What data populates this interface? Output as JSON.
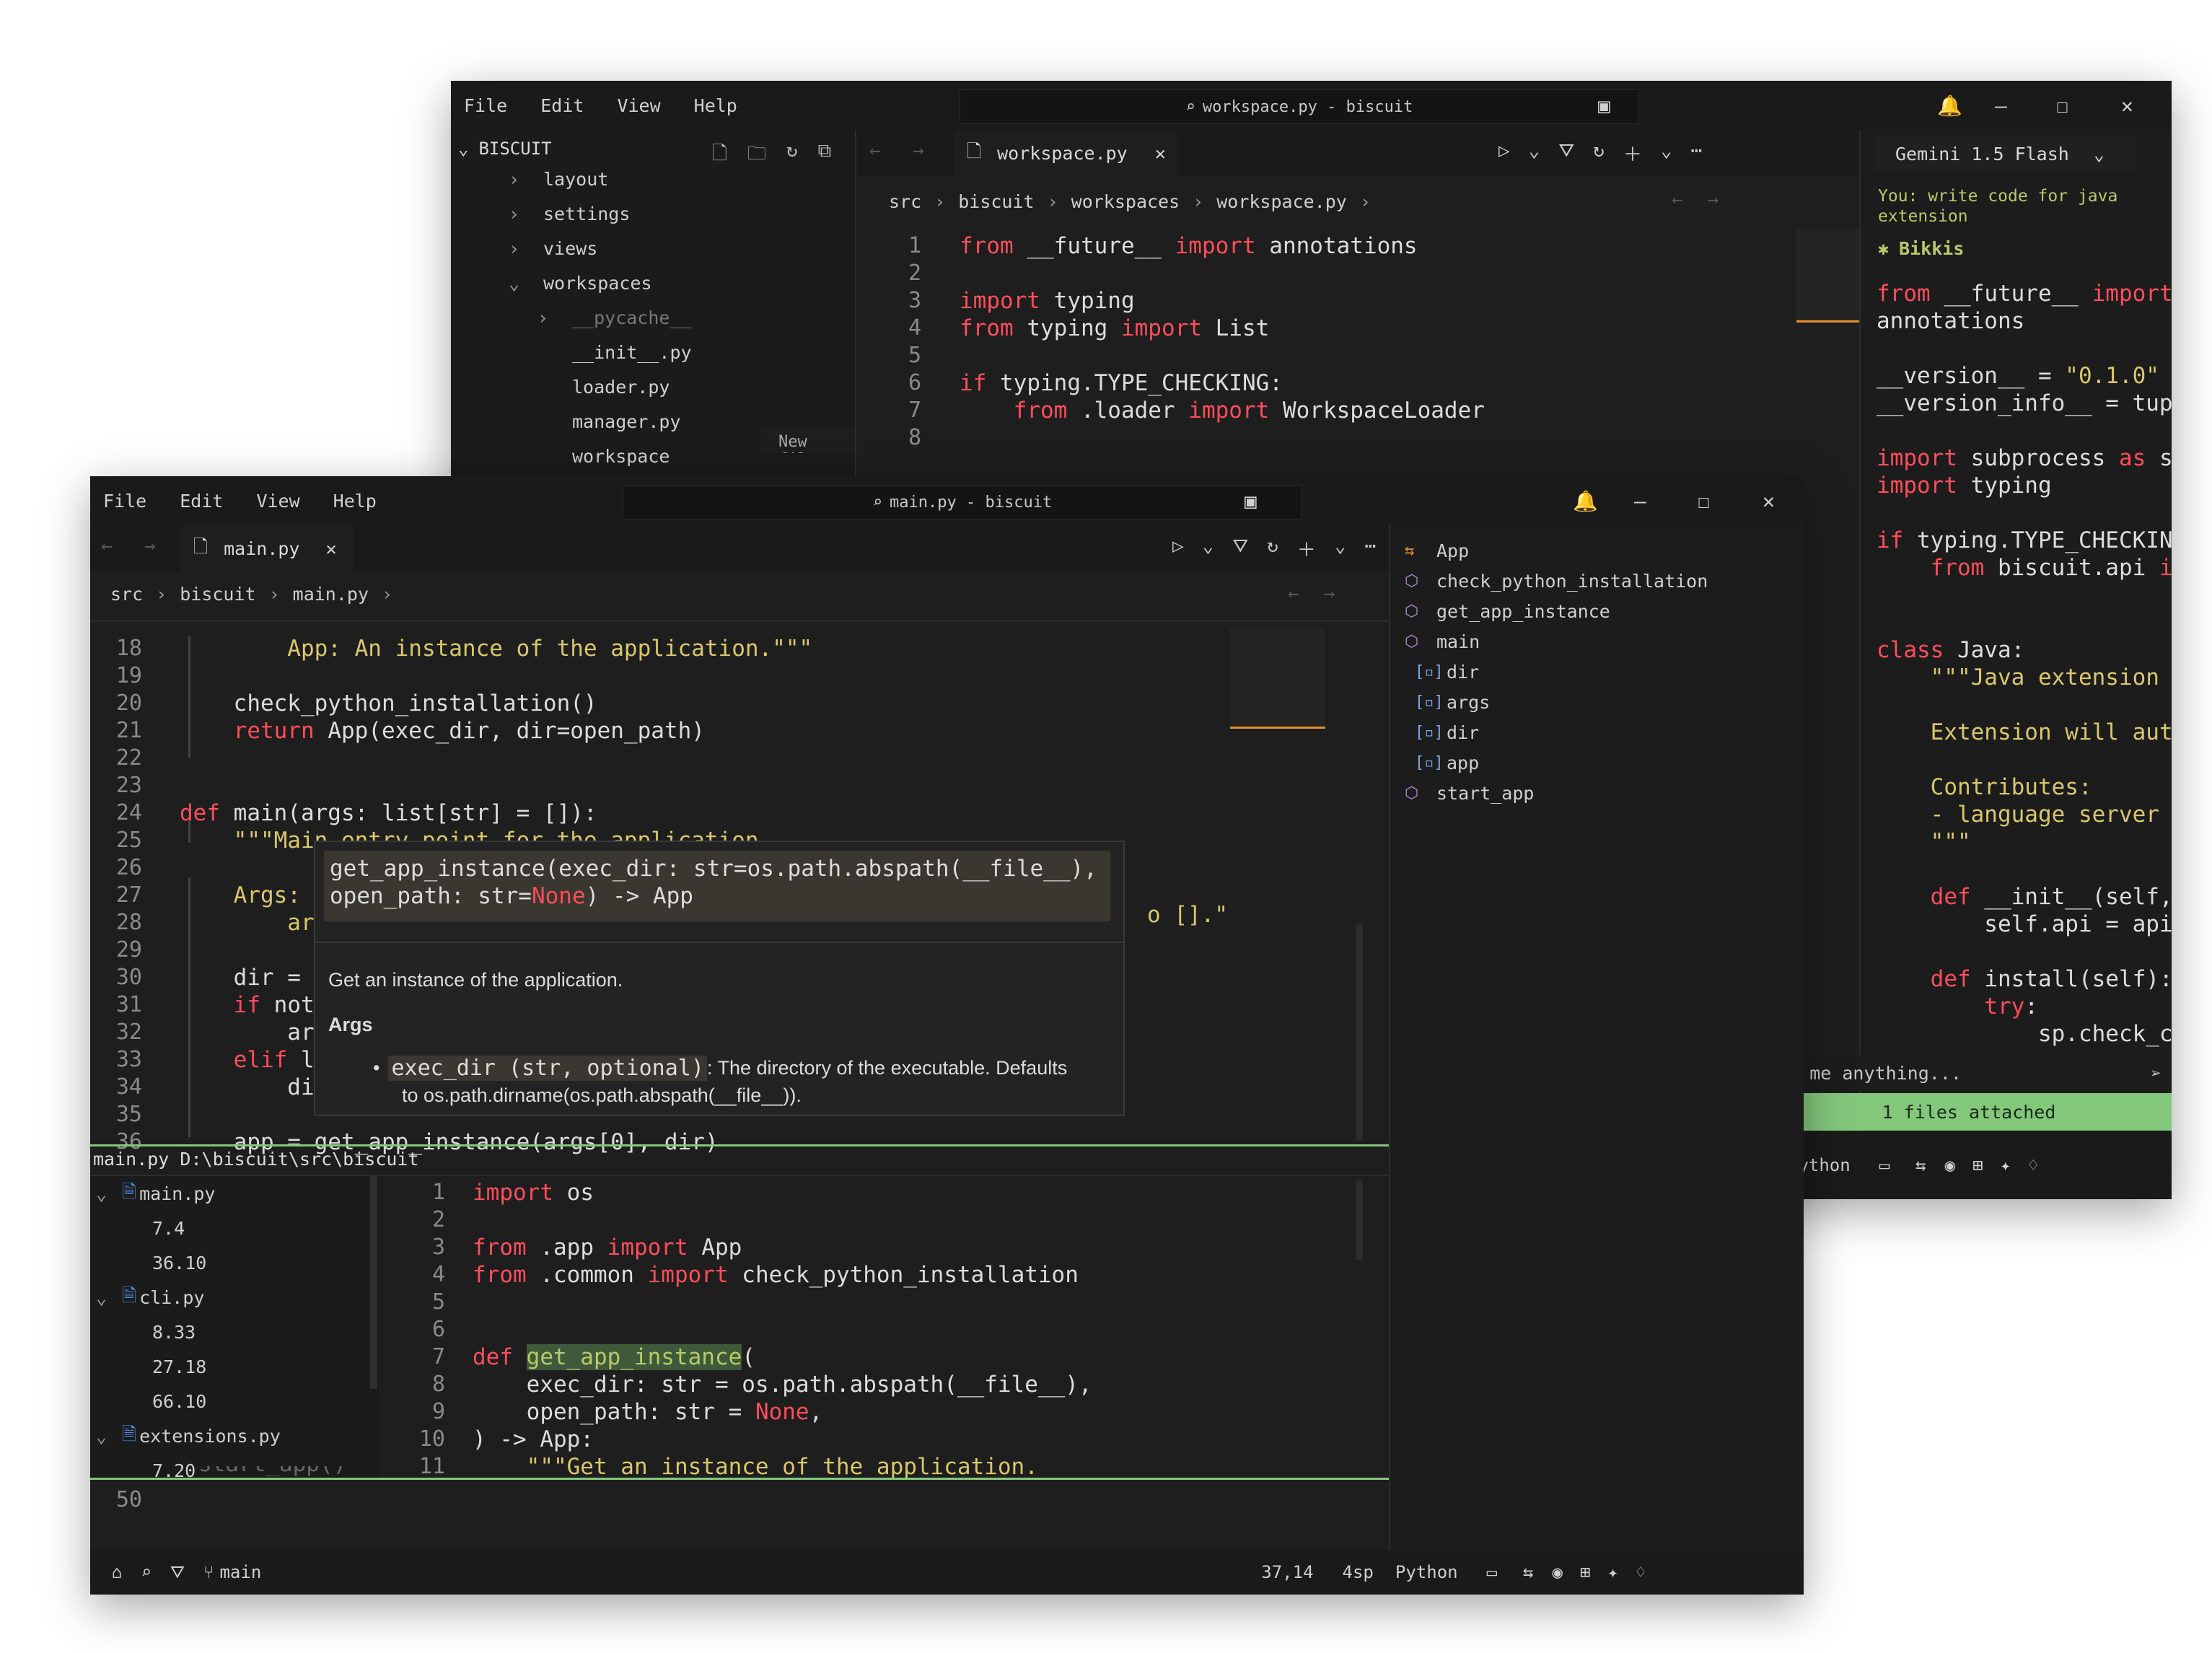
{
  "back": {
    "menu": [
      "File",
      "Edit",
      "View",
      "Help"
    ],
    "cmd_title": "workspace.py - biscuit",
    "explorer_title": "BISCUIT",
    "tree": [
      {
        "label": "layout",
        "indent": 1,
        "chev": "›"
      },
      {
        "label": "settings",
        "indent": 1,
        "chev": "›"
      },
      {
        "label": "views",
        "indent": 1,
        "chev": "›"
      },
      {
        "label": "workspaces",
        "indent": 1,
        "chev": "⌄"
      },
      {
        "label": "__pycache__",
        "indent": 2,
        "chev": "›"
      },
      {
        "label": "__init__.py",
        "indent": 2,
        "chev": ""
      },
      {
        "label": "loader.py",
        "indent": 2,
        "chev": ""
      },
      {
        "label": "manager.py",
        "indent": 2,
        "chev": ""
      },
      {
        "label": "workspace",
        "indent": 2,
        "chev": ""
      }
    ],
    "newfile_hint": "New file",
    "tab": "workspace.py",
    "crumbs": [
      "src",
      "biscuit",
      "workspaces",
      "workspace.py"
    ],
    "lines": [
      "1",
      "2",
      "3",
      "4",
      "5",
      "6",
      "7",
      "8"
    ],
    "code": [
      [
        [
          "kw",
          "from "
        ],
        [
          "plain",
          "__future__ "
        ],
        [
          "kw",
          "import "
        ],
        [
          "plain",
          "annotations"
        ]
      ],
      [],
      [
        [
          "kw",
          "import "
        ],
        [
          "plain",
          "typing"
        ]
      ],
      [
        [
          "kw",
          "from "
        ],
        [
          "plain",
          "typing "
        ],
        [
          "kw",
          "import "
        ],
        [
          "plain",
          "List"
        ]
      ],
      [],
      [
        [
          "kw",
          "if "
        ],
        [
          "plain",
          "typing.TYPE_CHECKING:"
        ]
      ],
      [
        [
          "plain",
          "    "
        ],
        [
          "kw",
          "from "
        ],
        [
          "plain",
          ".loader "
        ],
        [
          "kw",
          "import "
        ],
        [
          "plain",
          "WorkspaceLoader"
        ]
      ],
      []
    ],
    "ai": {
      "model": "Gemini 1.5 Flash",
      "you": "You: write code for java extension",
      "bot": "Bikkis",
      "code": [
        [
          [
            "kw",
            "from "
          ],
          [
            "plain",
            "__future__ "
          ],
          [
            "kw",
            "import"
          ]
        ],
        [
          [
            "plain",
            "annotations"
          ]
        ],
        [],
        [
          [
            "plain",
            "__version__ = "
          ],
          [
            "str",
            "\"0.1.0\""
          ]
        ],
        [
          [
            "plain",
            "__version_info__ = tuple([ir"
          ]
        ],
        [],
        [
          [
            "kw",
            "import "
          ],
          [
            "plain",
            "subprocess "
          ],
          [
            "kw",
            "as "
          ],
          [
            "plain",
            "sp"
          ]
        ],
        [
          [
            "kw",
            "import "
          ],
          [
            "plain",
            "typing"
          ]
        ],
        [],
        [
          [
            "kw",
            "if "
          ],
          [
            "plain",
            "typing.TYPE_CHECKING:"
          ]
        ],
        [
          [
            "plain",
            "    "
          ],
          [
            "kw",
            "from "
          ],
          [
            "plain",
            "biscuit.api "
          ],
          [
            "kw",
            "import"
          ]
        ],
        [],
        [],
        [
          [
            "kw",
            "class "
          ],
          [
            "plain",
            "Java:"
          ]
        ],
        [
          [
            "str",
            "    \"\"\"Java extension for Bi"
          ]
        ],
        [],
        [
          [
            "str",
            "    Extension will automatic"
          ]
        ],
        [],
        [
          [
            "str",
            "    Contributes:"
          ]
        ],
        [
          [
            "str",
            "    - language server config"
          ]
        ],
        [
          [
            "str",
            "    \"\"\""
          ]
        ],
        [],
        [
          [
            "plain",
            "    "
          ],
          [
            "kw",
            "def "
          ],
          [
            "plain",
            "__init__(self, api):"
          ]
        ],
        [
          [
            "plain",
            "        self.api = api"
          ]
        ],
        [],
        [
          [
            "plain",
            "    "
          ],
          [
            "kw",
            "def "
          ],
          [
            "plain",
            "install(self):"
          ]
        ],
        [
          [
            "plain",
            "        "
          ],
          [
            "kw",
            "try"
          ],
          [
            "plain",
            ":"
          ]
        ],
        [
          [
            "plain",
            "            sp.check_call([\""
          ]
        ]
      ],
      "ask_placeholder": "Ask me anything...",
      "attached": "1 files attached",
      "lang": "Python"
    }
  },
  "front": {
    "menu": [
      "File",
      "Edit",
      "View",
      "Help"
    ],
    "cmd_title": "main.py - biscuit",
    "tab": "main.py",
    "crumbs": [
      "src",
      "biscuit",
      "main.py"
    ],
    "lines": [
      "18",
      "19",
      "20",
      "21",
      "22",
      "23",
      "24",
      "25",
      "26",
      "27",
      "28",
      "29",
      "30",
      "31",
      "32",
      "33",
      "34",
      "35",
      "36"
    ],
    "code": [
      [
        [
          "plain",
          "    "
        ],
        [
          "str",
          "    App: An instance of the application.\"\"\""
        ]
      ],
      [],
      [
        [
          "plain",
          "    check_python_installation()"
        ]
      ],
      [
        [
          "plain",
          "    "
        ],
        [
          "kw",
          "return "
        ],
        [
          "plain",
          "App(exec_dir, dir=open_path)"
        ]
      ],
      [],
      [],
      [
        [
          "kw",
          "def "
        ],
        [
          "plain",
          "main(args: list[str] = []):"
        ]
      ],
      [
        [
          "str",
          "    \"\"\"Main entry point for the application."
        ]
      ],
      [],
      [
        [
          "str",
          "    Args:"
        ]
      ],
      [
        [
          "str",
          "        ar"
        ]
      ],
      [],
      [
        [
          "plain",
          "    dir ="
        ]
      ],
      [
        [
          "plain",
          "    "
        ],
        [
          "kw",
          "if "
        ],
        [
          "plain",
          "not"
        ]
      ],
      [
        [
          "plain",
          "        ar"
        ]
      ],
      [
        [
          "plain",
          "    "
        ],
        [
          "kw",
          "elif "
        ],
        [
          "plain",
          "l"
        ]
      ],
      [
        [
          "plain",
          "        di"
        ]
      ],
      [],
      [
        [
          "plain",
          "    app = get_app_instance(args[0], dir)"
        ]
      ]
    ],
    "right_tail": "o [].\"",
    "hover": {
      "sig1": "get_app_instance(exec_dir: str=os.path.abspath(__file__),",
      "sig2a": "open_path: str=",
      "sig2b": "None",
      "sig2c": ") -> App",
      "desc": "Get an instance of the application.",
      "args_title": "Args",
      "arg_code": "exec_dir (str, optional)",
      "arg_text1": ": The directory of the executable. Defaults",
      "arg_text2": "to os.path.dirname(os.path.abspath(__file__))."
    },
    "outline": [
      {
        "label": "App",
        "kind": "class",
        "indent": 0
      },
      {
        "label": "check_python_installation",
        "kind": "func",
        "indent": 0
      },
      {
        "label": "get_app_instance",
        "kind": "func",
        "indent": 0
      },
      {
        "label": "main",
        "kind": "func",
        "indent": 0
      },
      {
        "label": "dir",
        "kind": "var",
        "indent": 1
      },
      {
        "label": "args",
        "kind": "var",
        "indent": 1
      },
      {
        "label": "dir",
        "kind": "var",
        "indent": 1
      },
      {
        "label": "app",
        "kind": "var",
        "indent": 1
      },
      {
        "label": "start_app",
        "kind": "func",
        "indent": 0
      }
    ],
    "peek_header": "main.py D:\\biscuit\\src\\biscuit",
    "refs": [
      {
        "label": "main.py",
        "type": "file"
      },
      {
        "label": "7.4",
        "type": "ref"
      },
      {
        "label": "36.10",
        "type": "ref"
      },
      {
        "label": "cli.py",
        "type": "file"
      },
      {
        "label": "8.33",
        "type": "ref"
      },
      {
        "label": "27.18",
        "type": "ref"
      },
      {
        "label": "66.10",
        "type": "ref"
      },
      {
        "label": "extensions.py",
        "type": "file"
      },
      {
        "label": "7.20",
        "type": "ref"
      }
    ],
    "peek_lines": [
      "1",
      "2",
      "3",
      "4",
      "5",
      "6",
      "7",
      "8",
      "9",
      "10",
      "11"
    ],
    "peek_code": [
      [
        [
          "kw",
          "import "
        ],
        [
          "plain",
          "os"
        ]
      ],
      [],
      [
        [
          "kw",
          "from "
        ],
        [
          "plain",
          ".app "
        ],
        [
          "kw",
          "import "
        ],
        [
          "plain",
          "App"
        ]
      ],
      [
        [
          "kw",
          "from "
        ],
        [
          "plain",
          ".common "
        ],
        [
          "kw",
          "import "
        ],
        [
          "plain",
          "check_python_installation"
        ]
      ],
      [],
      [],
      [
        [
          "kw",
          "def "
        ],
        [
          "hl",
          "get_app_instance"
        ],
        [
          "plain",
          "("
        ]
      ],
      [
        [
          "plain",
          "    exec_dir: str = os.path.abspath(__file__),"
        ]
      ],
      [
        [
          "plain",
          "    open_path: str = "
        ],
        [
          "kw",
          "None"
        ],
        [
          "plain",
          ","
        ]
      ],
      [
        [
          "plain",
          ") -> App:"
        ]
      ],
      [
        [
          "str",
          "    \"\"\"Get an instance of the application."
        ]
      ]
    ],
    "after_peek_ln": "50",
    "after_peek_partial": "start_app()",
    "status": {
      "branch": "main",
      "pos": "37,14",
      "indent": "4sp",
      "lang": "Python"
    }
  }
}
